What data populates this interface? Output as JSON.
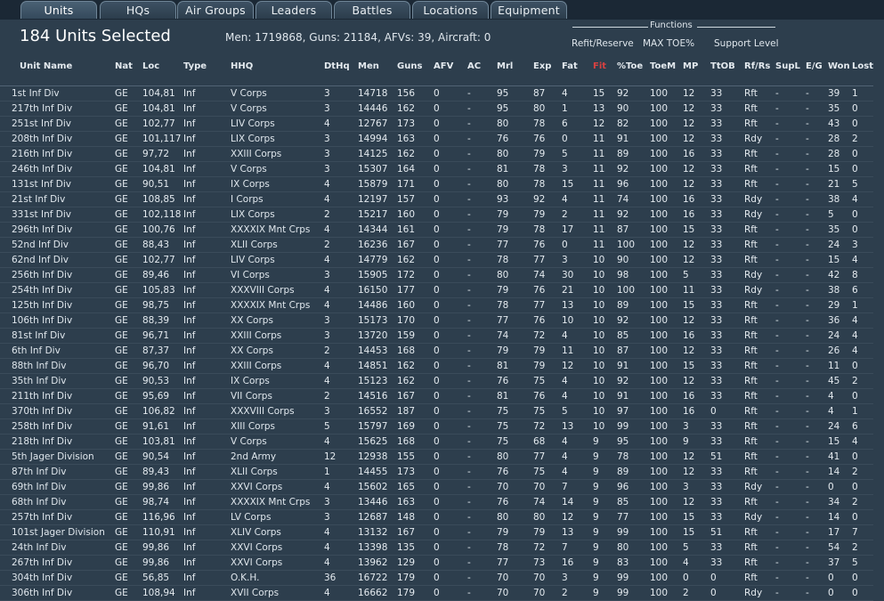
{
  "tabs": [
    {
      "label": "Units",
      "active": true
    },
    {
      "label": "HQs",
      "active": false
    },
    {
      "label": "Air Groups",
      "active": false
    },
    {
      "label": "Leaders",
      "active": false
    },
    {
      "label": "Battles",
      "active": false
    },
    {
      "label": "Locations",
      "active": false
    },
    {
      "label": "Equipment",
      "active": false
    }
  ],
  "header": {
    "title": "184 Units Selected",
    "summary": "Men: 1719868, Guns: 21184, AFVs: 39, Aircraft: 0"
  },
  "functions": {
    "title": "Functions",
    "buttons": [
      "Refit/Reserve",
      "MAX TOE%",
      "Support Level"
    ]
  },
  "table": {
    "columns": [
      "Unit Name",
      "Nat",
      "Loc",
      "Type",
      "HHQ",
      "DtHq",
      "Men",
      "Guns",
      "AFV",
      "AC",
      "Mrl",
      "Exp",
      "Fat",
      "Fit",
      "%Toe",
      "ToeM",
      "MP",
      "TtOB",
      "Rf/Rs",
      "SupL",
      "E/G",
      "Won",
      "Lost"
    ],
    "rows": [
      [
        "1st Inf Div",
        "GE",
        "104,81",
        "Inf",
        "V Corps",
        "3",
        "14718",
        "156",
        "0",
        "-",
        "95",
        "87",
        "4",
        "15",
        "92",
        "100",
        "12",
        "33",
        "Rft",
        "-",
        "-",
        "39",
        "1"
      ],
      [
        "217th Inf Div",
        "GE",
        "104,81",
        "Inf",
        "V Corps",
        "3",
        "14446",
        "162",
        "0",
        "-",
        "95",
        "80",
        "1",
        "13",
        "90",
        "100",
        "12",
        "33",
        "Rft",
        "-",
        "-",
        "35",
        "0"
      ],
      [
        "251st Inf Div",
        "GE",
        "102,77",
        "Inf",
        "LIV Corps",
        "4",
        "12767",
        "173",
        "0",
        "-",
        "80",
        "78",
        "6",
        "12",
        "82",
        "100",
        "12",
        "33",
        "Rft",
        "-",
        "-",
        "43",
        "0"
      ],
      [
        "208th Inf Div",
        "GE",
        "101,117",
        "Inf",
        "LIX Corps",
        "3",
        "14994",
        "163",
        "0",
        "-",
        "76",
        "76",
        "0",
        "11",
        "91",
        "100",
        "12",
        "33",
        "Rdy",
        "-",
        "-",
        "28",
        "2"
      ],
      [
        "216th Inf Div",
        "GE",
        "97,72",
        "Inf",
        "XXIII Corps",
        "3",
        "14125",
        "162",
        "0",
        "-",
        "80",
        "79",
        "5",
        "11",
        "89",
        "100",
        "16",
        "33",
        "Rft",
        "-",
        "-",
        "28",
        "0"
      ],
      [
        "246th Inf Div",
        "GE",
        "104,81",
        "Inf",
        "V Corps",
        "3",
        "15307",
        "164",
        "0",
        "-",
        "81",
        "78",
        "3",
        "11",
        "92",
        "100",
        "12",
        "33",
        "Rft",
        "-",
        "-",
        "15",
        "0"
      ],
      [
        "131st Inf Div",
        "GE",
        "90,51",
        "Inf",
        "IX Corps",
        "4",
        "15879",
        "171",
        "0",
        "-",
        "80",
        "78",
        "15",
        "11",
        "96",
        "100",
        "12",
        "33",
        "Rft",
        "-",
        "-",
        "21",
        "5"
      ],
      [
        "21st Inf Div",
        "GE",
        "108,85",
        "Inf",
        "I Corps",
        "4",
        "12197",
        "157",
        "0",
        "-",
        "93",
        "92",
        "4",
        "11",
        "74",
        "100",
        "16",
        "33",
        "Rdy",
        "-",
        "-",
        "38",
        "4"
      ],
      [
        "331st Inf Div",
        "GE",
        "102,118",
        "Inf",
        "LIX Corps",
        "2",
        "15217",
        "160",
        "0",
        "-",
        "79",
        "79",
        "2",
        "11",
        "92",
        "100",
        "16",
        "33",
        "Rdy",
        "-",
        "-",
        "5",
        "0"
      ],
      [
        "296th Inf Div",
        "GE",
        "100,76",
        "Inf",
        "XXXXIX Mnt Crps",
        "4",
        "14344",
        "161",
        "0",
        "-",
        "79",
        "78",
        "17",
        "11",
        "87",
        "100",
        "15",
        "33",
        "Rft",
        "-",
        "-",
        "35",
        "0"
      ],
      [
        "52nd Inf Div",
        "GE",
        "88,43",
        "Inf",
        "XLII Corps",
        "2",
        "16236",
        "167",
        "0",
        "-",
        "77",
        "76",
        "0",
        "11",
        "100",
        "100",
        "12",
        "33",
        "Rft",
        "-",
        "-",
        "24",
        "3"
      ],
      [
        "62nd Inf Div",
        "GE",
        "102,77",
        "Inf",
        "LIV Corps",
        "4",
        "14779",
        "162",
        "0",
        "-",
        "78",
        "77",
        "3",
        "10",
        "90",
        "100",
        "12",
        "33",
        "Rft",
        "-",
        "-",
        "15",
        "4"
      ],
      [
        "256th Inf Div",
        "GE",
        "89,46",
        "Inf",
        "VI Corps",
        "3",
        "15905",
        "172",
        "0",
        "-",
        "80",
        "74",
        "30",
        "10",
        "98",
        "100",
        "5",
        "33",
        "Rdy",
        "-",
        "-",
        "42",
        "8"
      ],
      [
        "254th Inf Div",
        "GE",
        "105,83",
        "Inf",
        "XXXVIII Corps",
        "4",
        "16150",
        "177",
        "0",
        "-",
        "79",
        "76",
        "21",
        "10",
        "100",
        "100",
        "11",
        "33",
        "Rdy",
        "-",
        "-",
        "38",
        "6"
      ],
      [
        "125th Inf Div",
        "GE",
        "98,75",
        "Inf",
        "XXXXIX Mnt Crps",
        "4",
        "14486",
        "160",
        "0",
        "-",
        "78",
        "77",
        "13",
        "10",
        "89",
        "100",
        "15",
        "33",
        "Rft",
        "-",
        "-",
        "29",
        "1"
      ],
      [
        "106th Inf Div",
        "GE",
        "88,39",
        "Inf",
        "XX Corps",
        "3",
        "15173",
        "170",
        "0",
        "-",
        "77",
        "76",
        "10",
        "10",
        "92",
        "100",
        "12",
        "33",
        "Rft",
        "-",
        "-",
        "36",
        "4"
      ],
      [
        "81st Inf Div",
        "GE",
        "96,71",
        "Inf",
        "XXIII Corps",
        "3",
        "13720",
        "159",
        "0",
        "-",
        "74",
        "72",
        "4",
        "10",
        "85",
        "100",
        "16",
        "33",
        "Rft",
        "-",
        "-",
        "24",
        "4"
      ],
      [
        "6th Inf Div",
        "GE",
        "87,37",
        "Inf",
        "XX Corps",
        "2",
        "14453",
        "168",
        "0",
        "-",
        "79",
        "79",
        "11",
        "10",
        "87",
        "100",
        "12",
        "33",
        "Rft",
        "-",
        "-",
        "26",
        "4"
      ],
      [
        "88th Inf Div",
        "GE",
        "96,70",
        "Inf",
        "XXIII Corps",
        "4",
        "14851",
        "162",
        "0",
        "-",
        "81",
        "79",
        "12",
        "10",
        "91",
        "100",
        "15",
        "33",
        "Rft",
        "-",
        "-",
        "11",
        "0"
      ],
      [
        "35th Inf Div",
        "GE",
        "90,53",
        "Inf",
        "IX Corps",
        "4",
        "15123",
        "162",
        "0",
        "-",
        "76",
        "75",
        "4",
        "10",
        "92",
        "100",
        "12",
        "33",
        "Rft",
        "-",
        "-",
        "45",
        "2"
      ],
      [
        "211th Inf Div",
        "GE",
        "95,69",
        "Inf",
        "VII Corps",
        "2",
        "14516",
        "167",
        "0",
        "-",
        "81",
        "76",
        "4",
        "10",
        "91",
        "100",
        "16",
        "33",
        "Rft",
        "-",
        "-",
        "4",
        "0"
      ],
      [
        "370th Inf Div",
        "GE",
        "106,82",
        "Inf",
        "XXXVIII Corps",
        "3",
        "16552",
        "187",
        "0",
        "-",
        "75",
        "75",
        "5",
        "10",
        "97",
        "100",
        "16",
        "0",
        "Rft",
        "-",
        "-",
        "4",
        "1"
      ],
      [
        "258th Inf Div",
        "GE",
        "91,61",
        "Inf",
        "XIII Corps",
        "5",
        "15797",
        "169",
        "0",
        "-",
        "75",
        "72",
        "13",
        "10",
        "99",
        "100",
        "3",
        "33",
        "Rft",
        "-",
        "-",
        "24",
        "6"
      ],
      [
        "218th Inf Div",
        "GE",
        "103,81",
        "Inf",
        "V Corps",
        "4",
        "15625",
        "168",
        "0",
        "-",
        "75",
        "68",
        "4",
        "9",
        "95",
        "100",
        "9",
        "33",
        "Rft",
        "-",
        "-",
        "15",
        "4"
      ],
      [
        "5th Jager Division",
        "GE",
        "90,54",
        "Inf",
        "2nd Army",
        "12",
        "12938",
        "155",
        "0",
        "-",
        "80",
        "77",
        "4",
        "9",
        "78",
        "100",
        "12",
        "51",
        "Rft",
        "-",
        "-",
        "41",
        "0"
      ],
      [
        "87th Inf Div",
        "GE",
        "89,43",
        "Inf",
        "XLII Corps",
        "1",
        "14455",
        "173",
        "0",
        "-",
        "76",
        "75",
        "4",
        "9",
        "89",
        "100",
        "12",
        "33",
        "Rft",
        "-",
        "-",
        "14",
        "2"
      ],
      [
        "69th Inf Div",
        "GE",
        "99,86",
        "Inf",
        "XXVI Corps",
        "4",
        "15602",
        "165",
        "0",
        "-",
        "70",
        "70",
        "7",
        "9",
        "96",
        "100",
        "3",
        "33",
        "Rdy",
        "-",
        "-",
        "0",
        "0"
      ],
      [
        "68th Inf Div",
        "GE",
        "98,74",
        "Inf",
        "XXXXIX Mnt Crps",
        "3",
        "13446",
        "163",
        "0",
        "-",
        "76",
        "74",
        "14",
        "9",
        "85",
        "100",
        "12",
        "33",
        "Rft",
        "-",
        "-",
        "34",
        "2"
      ],
      [
        "257th Inf Div",
        "GE",
        "116,96",
        "Inf",
        "LV Corps",
        "3",
        "12687",
        "148",
        "0",
        "-",
        "80",
        "80",
        "12",
        "9",
        "77",
        "100",
        "15",
        "33",
        "Rdy",
        "-",
        "-",
        "14",
        "0"
      ],
      [
        "101st Jager Division",
        "GE",
        "110,91",
        "Inf",
        "XLIV Corps",
        "4",
        "13132",
        "167",
        "0",
        "-",
        "79",
        "79",
        "13",
        "9",
        "99",
        "100",
        "15",
        "51",
        "Rft",
        "-",
        "-",
        "17",
        "7"
      ],
      [
        "24th Inf Div",
        "GE",
        "99,86",
        "Inf",
        "XXVI Corps",
        "4",
        "13398",
        "135",
        "0",
        "-",
        "78",
        "72",
        "7",
        "9",
        "80",
        "100",
        "5",
        "33",
        "Rft",
        "-",
        "-",
        "54",
        "2"
      ],
      [
        "267th Inf Div",
        "GE",
        "99,86",
        "Inf",
        "XXVI Corps",
        "4",
        "13962",
        "129",
        "0",
        "-",
        "77",
        "73",
        "16",
        "9",
        "83",
        "100",
        "4",
        "33",
        "Rft",
        "-",
        "-",
        "37",
        "5"
      ],
      [
        "304th Inf Div",
        "GE",
        "56,85",
        "Inf",
        "O.K.H.",
        "36",
        "16722",
        "179",
        "0",
        "-",
        "70",
        "70",
        "3",
        "9",
        "99",
        "100",
        "0",
        "0",
        "Rft",
        "-",
        "-",
        "0",
        "0"
      ],
      [
        "306th Inf Div",
        "GE",
        "108,94",
        "Inf",
        "XVII Corps",
        "4",
        "16662",
        "179",
        "0",
        "-",
        "70",
        "70",
        "2",
        "9",
        "99",
        "100",
        "2",
        "0",
        "Rdy",
        "-",
        "-",
        "0",
        "0"
      ]
    ]
  },
  "colors": {
    "background": "#2d3e4d",
    "tabbar": "#1b2835",
    "text": "#e4eaef",
    "header_highlight": "#d84141"
  }
}
